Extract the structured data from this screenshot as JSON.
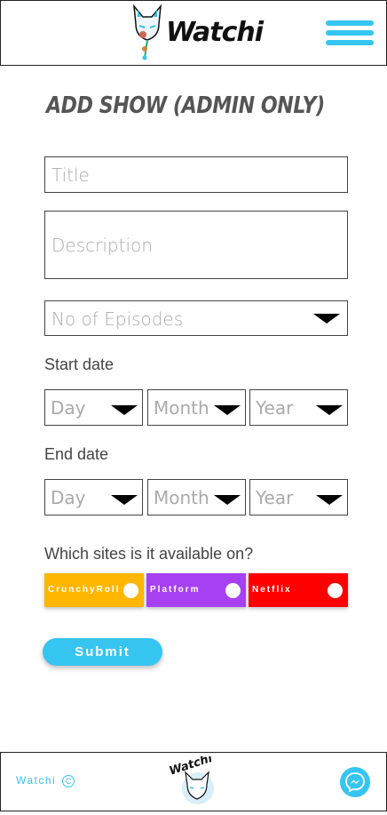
{
  "header": {
    "logo_text": "Watchi"
  },
  "page": {
    "title": "Add Show (Admin Only)"
  },
  "form": {
    "title_placeholder": "Title",
    "description_placeholder": "Description",
    "episodes_placeholder": "No of Episodes",
    "start_label": "Start date",
    "end_label": "End date",
    "day_placeholder": "Day",
    "month_placeholder": "Month",
    "year_placeholder": "Year",
    "sites_label": "Which sites is it available on?",
    "sites": [
      {
        "label": "CrunchyRoll",
        "color": "#ffb600"
      },
      {
        "label": "Platform",
        "color": "#a640f0"
      },
      {
        "label": "Netflix",
        "color": "#ff0000"
      }
    ],
    "submit_label": "Submit"
  },
  "footer": {
    "brand": "Watchi",
    "copyright_symbol": "C"
  },
  "colors": {
    "accent": "#36c5f0"
  }
}
